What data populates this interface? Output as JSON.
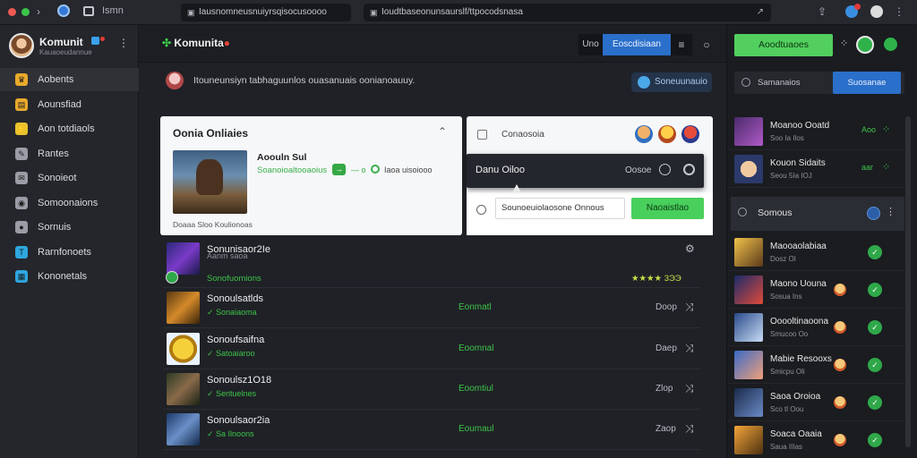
{
  "browser": {
    "tab_title": "Ismn",
    "url_left": "Iausnomneusnuiyrsqisocusoooo",
    "url_right": "Ioudtbaseonunsaurslf/ttpocodsnasa",
    "back_glyph": "‹",
    "forward_glyph": "›"
  },
  "profile": {
    "name": "Komunit",
    "subtitle": "Kauaoeudannue"
  },
  "sidebar": {
    "items": [
      {
        "label": "Aobents",
        "icon": "trophy-icon",
        "color": "#e9a92d"
      },
      {
        "label": "Aounsfiad",
        "icon": "bag-icon",
        "color": "#e9a92d"
      },
      {
        "label": "Aon totdiaols",
        "icon": "bolt-icon",
        "color": "#e9c22d"
      },
      {
        "label": "Rantes",
        "icon": "pen-icon",
        "color": "#9a9da5"
      },
      {
        "label": "Sonoieot",
        "icon": "chat-icon",
        "color": "#9a9da5"
      },
      {
        "label": "Somoonaions",
        "icon": "shield-icon",
        "color": "#9a9da5"
      },
      {
        "label": "Sornuis",
        "icon": "pin-icon",
        "color": "#9a9da5"
      },
      {
        "label": "Rarnfonoets",
        "icon": "text-icon",
        "color": "#2ea7e0"
      },
      {
        "label": "Kononetals",
        "icon": "window-icon",
        "color": "#2ea7e0"
      }
    ]
  },
  "header": {
    "brand": "Komunita",
    "seg_small": "Uno",
    "seg_active": "Eoscdisiaan",
    "seg_icon": "≡",
    "status_glyph": "○"
  },
  "banner": {
    "text": "Itouneunsiyn tabhaguunlos ouasanuais oonianoauuy.",
    "button": "Soneuunauio"
  },
  "card": {
    "title": "Oonia Onliaies",
    "game_name": "Aoouln Sul",
    "game_line": "Soanoioaltooaoius",
    "arrow": "→",
    "between": "—  o",
    "tag": "Iaoa uisoiooo",
    "caption": "Doaaa Sloo Koulionoas"
  },
  "friends_card": {
    "label": "Conaosoia"
  },
  "popup": {
    "title": "Danu Oiloo",
    "right_label": "Oosoe"
  },
  "invite": {
    "input": "Sounoeuiolaosone Onnous",
    "button": "Naoaistlao"
  },
  "rows": [
    {
      "name": "Sonunisaor2Ie",
      "sub": "Aanm saoa",
      "status": "",
      "time": "",
      "badge": "Sonofuomions",
      "progress": "★★★★ 3ЭЭ"
    },
    {
      "name": "Sonoulsatlds",
      "sub": "Sonaiaoma",
      "status": "Eonmatl",
      "time": "Doop"
    },
    {
      "name": "Sonoufsaifna",
      "sub": "Satoaiaroo",
      "status": "Eoomnal",
      "time": "Daep"
    },
    {
      "name": "Sonoulsz1O18",
      "sub": "Serituelnes",
      "status": "Eoomtiul",
      "time": "Zlop"
    },
    {
      "name": "Sonoulsaor2ia",
      "sub": "Sa Ilnoons",
      "status": "Eoumaul",
      "time": "Zaop"
    }
  ],
  "right_panel": {
    "cta": "Aoodtuaoes",
    "search": "Samanaios",
    "search_btn": "Suosanae",
    "section": "Somous",
    "top_items": [
      {
        "name": "Moanoo Ooatd",
        "sub": "Soo Ia Ilos",
        "tag": "Aoo"
      },
      {
        "name": "Kouon Sidaits",
        "sub": "Seou 5Ia IOJ",
        "tag": "aar"
      }
    ],
    "list": [
      {
        "name": "Maooaolabiaa",
        "sub": "Dosz OI"
      },
      {
        "name": "Maono Uouna",
        "sub": "Sosua Ins"
      },
      {
        "name": "Ooooltinaoona",
        "sub": "Smucoo Oo"
      },
      {
        "name": "Mabie Resooxs",
        "sub": "Smicpu Oli"
      },
      {
        "name": "Saoa Oroioa",
        "sub": "Sco tl Oou"
      },
      {
        "name": "Soaca Oaaia",
        "sub": "Saua IIIas"
      }
    ]
  },
  "colors": {
    "accent_green": "#3ec44a",
    "accent_blue": "#2a6fc9",
    "panel_bg": "#1a1c20"
  }
}
